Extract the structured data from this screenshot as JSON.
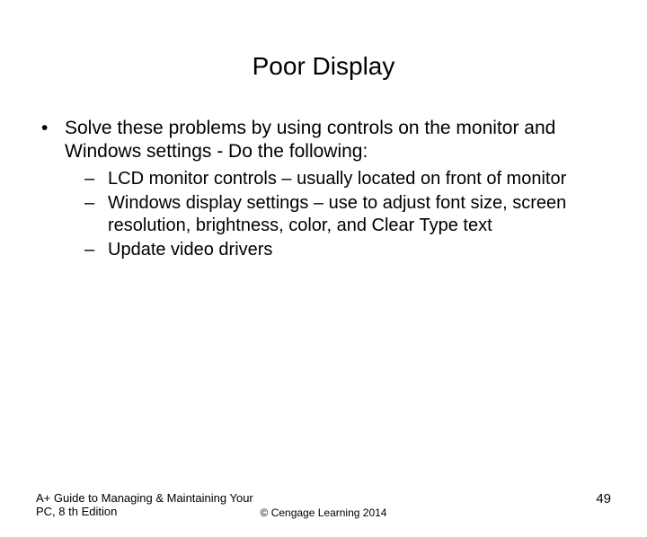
{
  "title": "Poor Display",
  "bullets": {
    "main": "Solve these problems by using controls on the monitor and Windows settings - Do the following:",
    "subs": [
      "LCD monitor controls – usually located on front of monitor",
      "Windows display settings – use to adjust font size, screen resolution, brightness, color, and Clear Type text",
      "Update video drivers"
    ]
  },
  "footer": {
    "left": "A+ Guide to Managing & Maintaining Your PC, 8 th Edition",
    "center": "© Cengage Learning  2014",
    "page": "49"
  }
}
